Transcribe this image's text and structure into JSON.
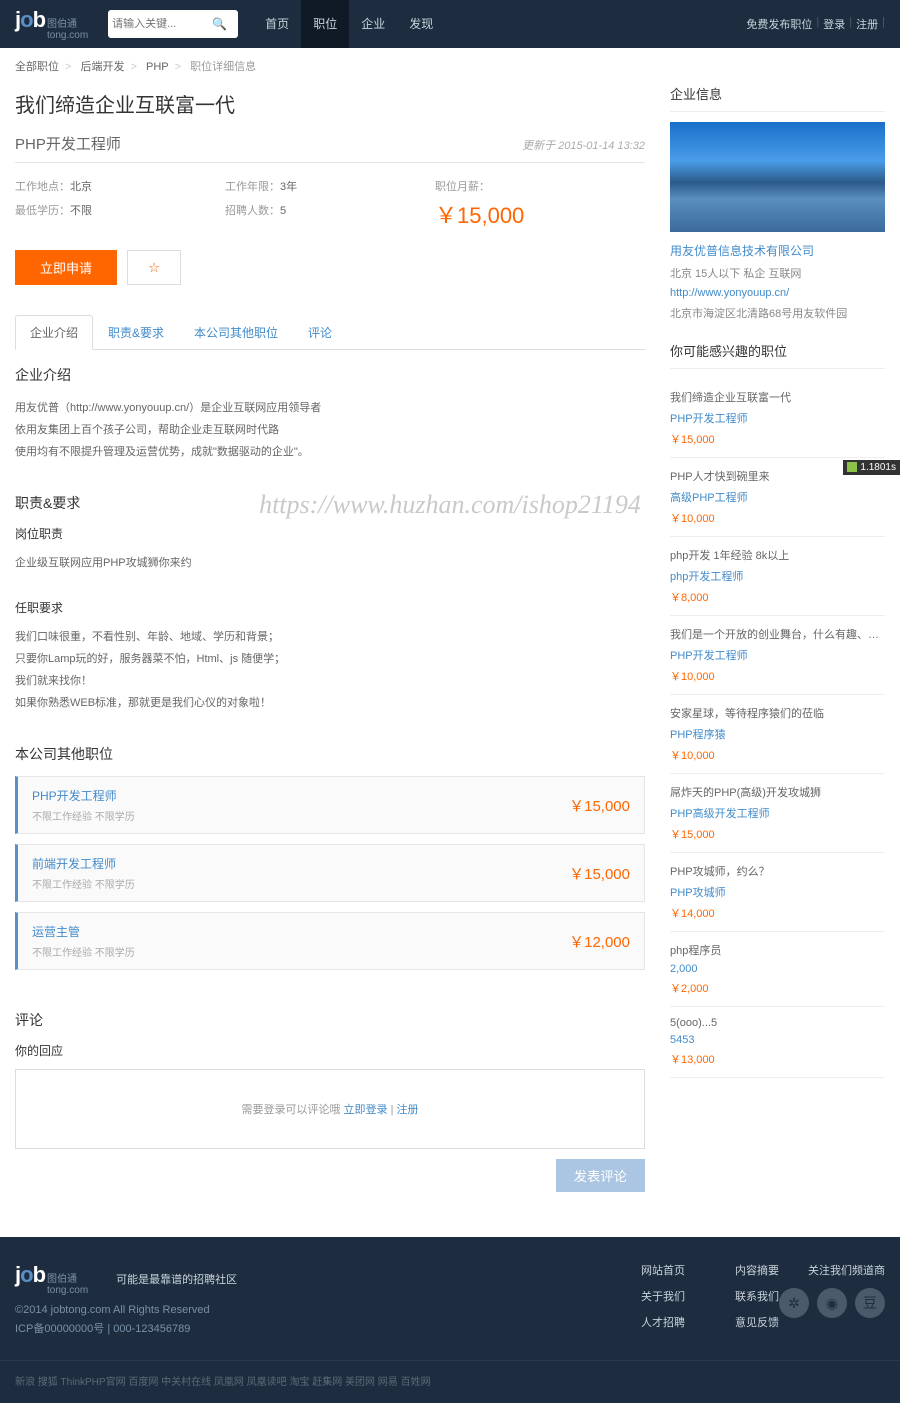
{
  "header": {
    "logo_main": "job",
    "logo_sub": "图伯通",
    "logo_domain": "tong.com",
    "search_placeholder": "请输入关键...",
    "nav": [
      "首页",
      "职位",
      "企业",
      "发现"
    ],
    "nav_active": 1,
    "user": [
      "免费发布职位",
      "登录",
      "注册"
    ]
  },
  "breadcrumb": [
    "全部职位",
    "后端开发",
    "PHP",
    "职位详细信息"
  ],
  "job": {
    "slogan": "我们缔造企业互联富一代",
    "title": "PHP开发工程师",
    "updated": "更新于 2015-01-14 13:32",
    "location_k": "工作地点：",
    "location_v": "北京",
    "exp_k": "工作年限：",
    "exp_v": "3年",
    "edu_k": "最低学历：",
    "edu_v": "不限",
    "count_k": "招聘人数：",
    "count_v": "5",
    "salary_k": "职位月薪：",
    "salary_v": "￥15,000",
    "apply": "立即申请",
    "fav": "☆"
  },
  "tabs": [
    "企业介绍",
    "职责&要求",
    "本公司其他职位",
    "评论"
  ],
  "intro": {
    "title": "企业介绍",
    "lines": [
      "用友优普（http://www.yonyouup.cn/）是企业互联网应用领导者",
      "依用友集团上百个孩子公司，帮助企业走互联网时代路",
      "使用均有不限提升管理及运营优势，成就\"数据驱动的企业\"。"
    ]
  },
  "duty": {
    "title": "职责&要求",
    "sub1": "岗位职责",
    "line1": "企业级互联网应用PHP攻城狮你来约",
    "sub2": "任职要求",
    "lines2": [
      "我们口味很重，不看性别、年龄、地域、学历和背景；",
      "只要你Lamp玩的好，服务器菜不怕，Html、js 随便学；",
      "我们就来找你！",
      "如果你熟悉WEB标准，那就更是我们心仪的对象啦！"
    ]
  },
  "others": {
    "title": "本公司其他职位",
    "items": [
      {
        "t": "PHP开发工程师",
        "m": "不限工作经验 不限学历",
        "s": "￥15,000"
      },
      {
        "t": "前端开发工程师",
        "m": "不限工作经验 不限学历",
        "s": "￥15,000"
      },
      {
        "t": "运营主管",
        "m": "不限工作经验 不限学历",
        "s": "￥12,000"
      }
    ]
  },
  "comment": {
    "title": "评论",
    "label": "你的回应",
    "hint_pre": "需要登录可以评论哦 ",
    "hint_login": "立即登录",
    "hint_sep": " | ",
    "hint_reg": "注册",
    "btn": "发表评论"
  },
  "company": {
    "section": "企业信息",
    "name": "用友优普信息技术有限公司",
    "meta": "北京   15人以下   私企   互联网",
    "url": "http://www.yonyouup.cn/",
    "addr": "北京市海淀区北清路68号用友软件园"
  },
  "rec": {
    "title": "你可能感兴趣的职位",
    "items": [
      {
        "t": "我们缔造企业互联富一代",
        "p": "PHP开发工程师",
        "s": "￥15,000"
      },
      {
        "t": "PHP人才快到碗里来",
        "p": "高级PHP工程师",
        "s": "￥10,000"
      },
      {
        "t": "php开发 1年经验 8k以上",
        "p": "php开发工程师",
        "s": "￥8,000"
      },
      {
        "t": "我们是一个开放的创业舞台，什么有趣、够任性、...",
        "p": "PHP开发工程师",
        "s": "￥10,000"
      },
      {
        "t": "安家星球，等待程序猿们的莅临",
        "p": "PHP程序猿",
        "s": "￥10,000"
      },
      {
        "t": "屌炸天的PHP(高级)开发攻城狮",
        "p": "PHP高级开发工程师",
        "s": "￥15,000"
      },
      {
        "t": "PHP攻城师，约么？",
        "p": "PHP攻城师",
        "s": "￥14,000"
      },
      {
        "t": "php程序员",
        "p": "2,000",
        "s": "￥2,000"
      },
      {
        "t": "5(ooo)...5",
        "p": "5453",
        "s": "￥13,000"
      }
    ]
  },
  "footer": {
    "tagline": "可能是最靠谱的招聘社区",
    "copy": "©2014 jobtong.com All Rights Reserved",
    "icp": "ICP备00000000号 | 000-123456789",
    "col1": [
      "网站首页",
      "关于我们",
      "人才招聘"
    ],
    "col2": [
      "内容摘要",
      "联系我们",
      "意见反馈"
    ],
    "follow": "关注我们频道商",
    "friends_label": "新浪 搜狐 ThinkPHP官网 百度网 中关村在线 凤凰网 凤凰读吧 淘宝 赶集网 美团网 网易 百姓网"
  },
  "watermark": "https://www.huzhan.com/ishop21194",
  "timer": "1.1801s"
}
